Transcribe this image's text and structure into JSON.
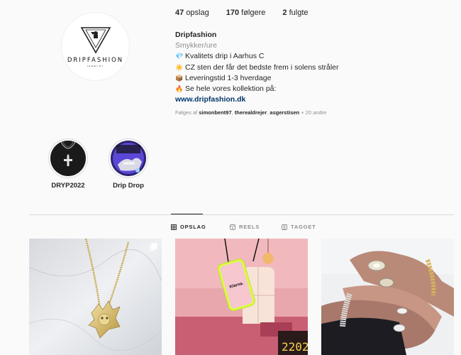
{
  "profile": {
    "logo_text": "DRIPFASHION",
    "logo_subtext": "JEWELRY",
    "stats": [
      {
        "count": "47",
        "label": "opslag"
      },
      {
        "count": "170",
        "label": "følgere"
      },
      {
        "count": "2",
        "label": "fulgte"
      }
    ],
    "name": "Dripfashion",
    "category": "Smykker/ure",
    "bio_lines": [
      {
        "icon": "💎",
        "text": "Kvalitets drip i Aarhus C"
      },
      {
        "icon": "☀️",
        "text": "CZ sten der får det bedste frem i solens stråler"
      },
      {
        "icon": "📦",
        "text": "Leveringstid 1-3 hverdage"
      },
      {
        "icon": "🔥",
        "text": "Se hele vores kollektion på:"
      }
    ],
    "website": "www.dripfashion.dk",
    "followed_by_prefix": "Følges af",
    "followed_by": [
      "simonbent97",
      "therealdrejer",
      "asgerstisen"
    ],
    "followed_by_more": "+ 20 andre"
  },
  "highlights": [
    {
      "label": "DRYP2022"
    },
    {
      "label": "Drip Drop"
    }
  ],
  "tabs": [
    {
      "label": "OPSLAG",
      "icon": "grid-icon",
      "active": true
    },
    {
      "label": "REELS",
      "icon": "reels-icon",
      "active": false
    },
    {
      "label": "TAGGET",
      "icon": "tagged-icon",
      "active": false
    }
  ],
  "posts": [
    {
      "kind": "necklace-photo",
      "multi": true
    },
    {
      "kind": "phone-pendant-photo",
      "multi": false,
      "phone_text": "Klarna."
    },
    {
      "kind": "bracelet-rings-photo",
      "multi": false
    }
  ],
  "colors": {
    "link": "#00376b",
    "muted": "#8e8e8e",
    "text": "#262626",
    "divider": "#dbdbdb"
  }
}
